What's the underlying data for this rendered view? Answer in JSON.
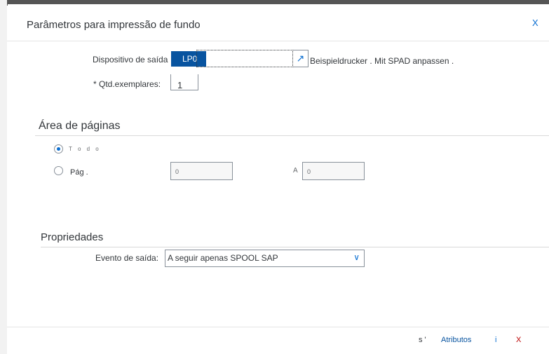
{
  "dialog": {
    "title": "Parâmetros para impressão de fundo",
    "close_label": "X"
  },
  "output": {
    "device_label": "Dispositivo de saída",
    "device_value": "LP0",
    "device_description": "Beispieldrucker . Mit SPAD anpassen .",
    "copies_label": "* Qtd.exemplares:",
    "copies_value": "1"
  },
  "page_area": {
    "section_title": "Área de páginas",
    "all_label": "T o d o",
    "all_selected": true,
    "pages_label": "Pág .",
    "from_value": "0",
    "to_label": "A",
    "to_value": "0"
  },
  "properties": {
    "section_title": "Propriedades",
    "event_label": "Evento de saída:",
    "event_value": "A seguir apenas SPOOL SAP"
  },
  "footer": {
    "s_label": "s '",
    "attributes_label": "Atributos",
    "info_label": "i",
    "close_label": "X"
  },
  "colors": {
    "accent": "#0a6ed1",
    "selection": "#0854a0",
    "close_red": "#bb0000"
  }
}
